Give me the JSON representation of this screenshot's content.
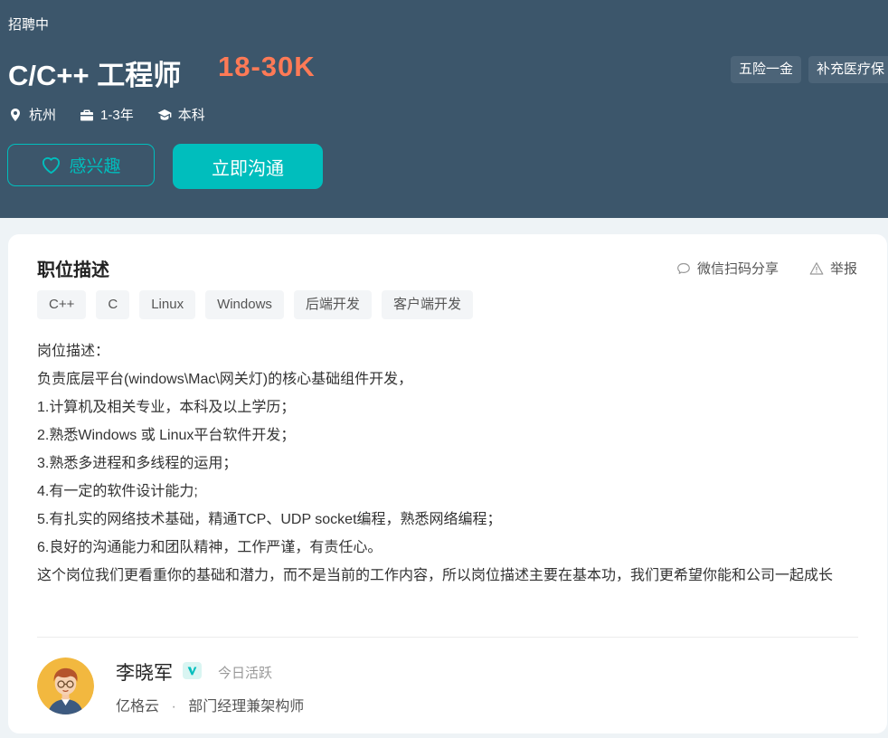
{
  "job": {
    "status": "招聘中",
    "title": "C/C++ 工程师",
    "salary": "18-30K",
    "benefits": [
      "五险一金",
      "补充医疗保"
    ],
    "meta": {
      "location": "杭州",
      "experience": "1-3年",
      "education": "本科"
    },
    "buttons": {
      "interest": "感兴趣",
      "chat": "立即沟通"
    }
  },
  "description_section": {
    "title": "职位描述",
    "share_label": "微信扫码分享",
    "report_label": "举报",
    "tags": [
      "C++",
      "C",
      "Linux",
      "Windows",
      "后端开发",
      "客户端开发"
    ],
    "lines": [
      "岗位描述：",
      "负责底层平台(windows\\Mac\\网关灯)的核心基础组件开发，",
      "1.计算机及相关专业，本科及以上学历；",
      "2.熟悉Windows 或 Linux平台软件开发；",
      "3.熟悉多进程和多线程的运用；",
      "4.有一定的软件设计能力;",
      "5.有扎实的网络技术基础，精通TCP、UDP socket编程，熟悉网络编程；",
      "6.良好的沟通能力和团队精神，工作严谨，有责任心。",
      "这个岗位我们更看重你的基础和潜力，而不是当前的工作内容，所以岗位描述主要在基本功，我们更希望你能和公司一起成长"
    ]
  },
  "recruiter": {
    "name": "李晓军",
    "active_status": "今日活跃",
    "company": "亿格云",
    "separator": "·",
    "position": "部门经理兼架构师"
  },
  "colors": {
    "header_bg": "#3c566b",
    "accent": "#00bebd",
    "salary": "#ff7a56"
  }
}
